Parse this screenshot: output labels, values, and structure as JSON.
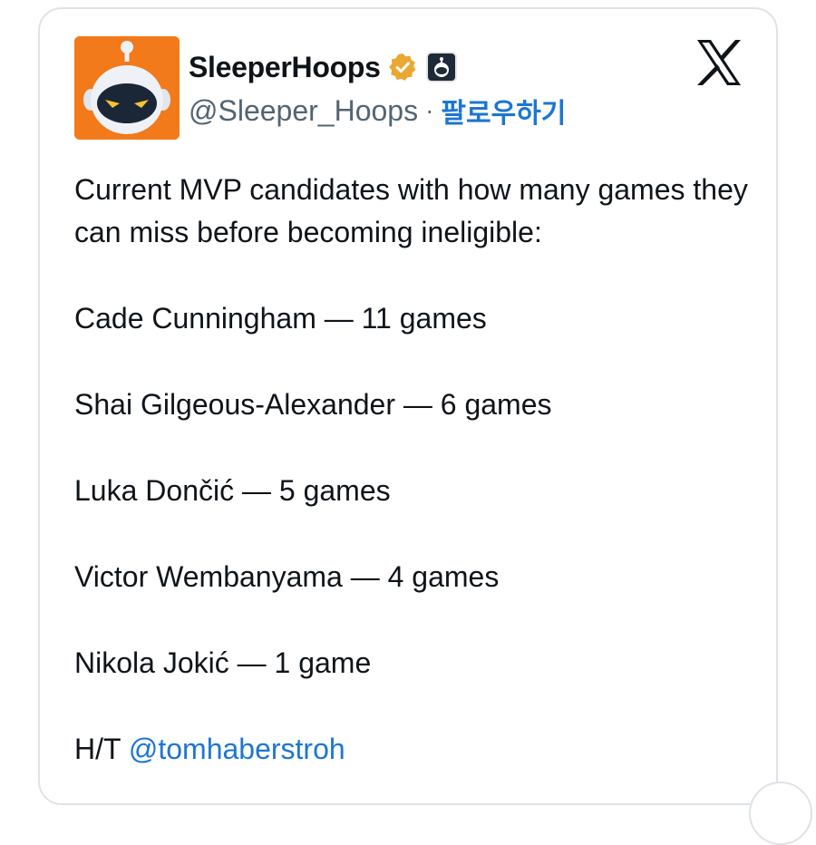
{
  "author": {
    "display_name": "SleeperHoops",
    "handle": "@Sleeper_Hoops",
    "separator": "·",
    "follow_label": "팔로우하기"
  },
  "tweet": {
    "intro": "Current MVP candidates with how many games they can miss before becoming ineligible:",
    "lines": [
      "Cade Cunningham — 11 games",
      "Shai Gilgeous-Alexander — 6 games",
      "Luka Dončić — 5 games",
      "Victor Wembanyama — 4 games",
      "Nikola Jokić — 1 game"
    ],
    "ht_prefix": "H/T",
    "ht_mention": "@tomhaberstroh"
  },
  "colors": {
    "avatar_bg": "#f27a1a",
    "link": "#1d76d2",
    "verified": "#e8a832"
  },
  "icons": {
    "verified": "gold-verified-badge-icon",
    "affiliate": "affiliate-badge-icon",
    "brand": "x-logo-icon"
  }
}
